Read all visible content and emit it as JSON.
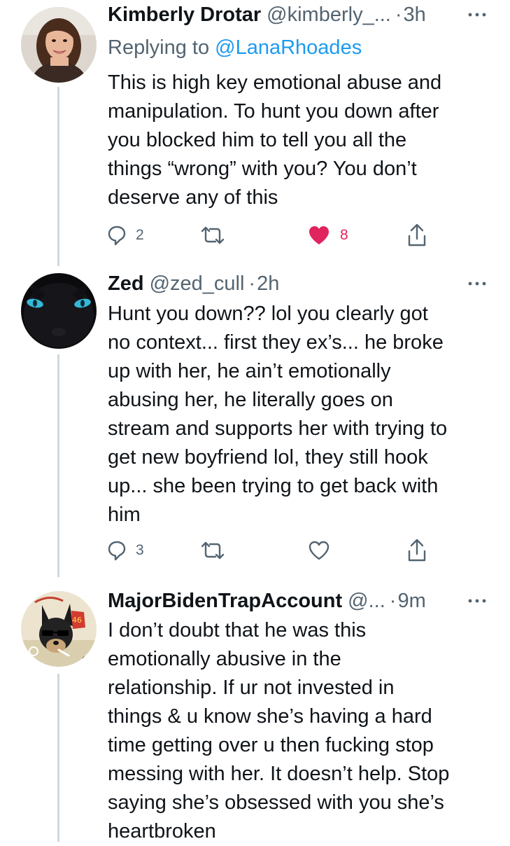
{
  "tweets": [
    {
      "name": "Kimberly Drotar",
      "handle": "@kimberly_...",
      "separator": "·",
      "time": "3h",
      "replying_label": "Replying to",
      "replying_to": "@LanaRhoades",
      "text": "This is high key emotional abuse and\nmanipulation. To hunt you down after\nyou blocked him to tell you all the\nthings “wrong” with you? You don’t\ndeserve any of this",
      "reply_count": "2",
      "retweet_count": "",
      "like_count": "8",
      "liked": true,
      "avatar_icon": "woman-portrait-avatar"
    },
    {
      "name": "Zed",
      "handle": "@zed_cull",
      "separator": "·",
      "time": "2h",
      "text": "Hunt you down?? lol you clearly got\nno context... first they ex’s... he broke\nup with her, he ain’t emotionally\nabusing her, he literally goes on\nstream and supports her with trying to\nget new boyfriend lol, they still hook\nup... she been trying to get back with\nhim",
      "reply_count": "3",
      "retweet_count": "",
      "like_count": "",
      "liked": false,
      "avatar_icon": "black-panther-eyes-avatar"
    },
    {
      "name": "MajorBidenTrapAccount",
      "handle": "@...",
      "separator": "·",
      "time": "9m",
      "text": "I don’t doubt that he was this\nemotionally abusive in the\nrelationship. If ur not invested in\nthings & u know she’s having a hard\ntime getting over u then fucking stop\nmessing with her. It doesn’t help. Stop\nsaying she’s obsessed with you she’s\nheartbroken",
      "avatar_icon": "dog-with-sunglasses-avatar",
      "avatar_badge": "46"
    }
  ],
  "colors": {
    "text": "#0f1419",
    "secondary": "#536471",
    "link": "#1d9bf0",
    "like": "#e0245e",
    "thread_line": "#cfd9de"
  }
}
